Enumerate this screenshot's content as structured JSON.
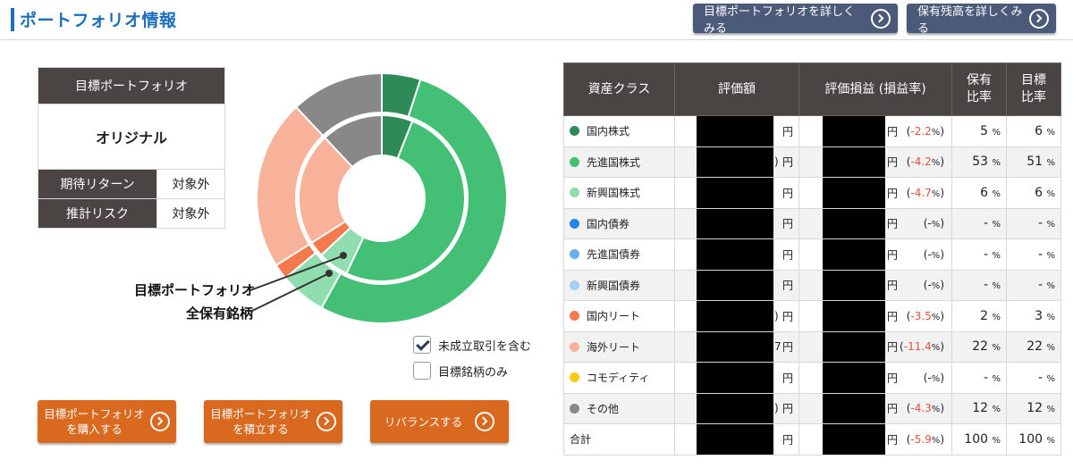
{
  "header": {
    "title": "ポートフォリオ情報",
    "btn_target_detail": "目標ポートフォリオを詳しくみる",
    "btn_holdings_detail": "保有残高を詳しくみる"
  },
  "target_panel": {
    "header": "目標ポートフォリオ",
    "name": "オリジナル",
    "expected_return_label": "期待リターン",
    "expected_return_value": "対象外",
    "risk_label": "推計リスク",
    "risk_value": "対象外"
  },
  "chart_data": {
    "type": "pie",
    "series": [
      {
        "name": "目標ポートフォリオ",
        "values": [
          6,
          51,
          6,
          0,
          0,
          0,
          3,
          22,
          0,
          12
        ]
      },
      {
        "name": "全保有銘柄",
        "values": [
          5,
          53,
          6,
          0,
          0,
          0,
          2,
          22,
          0,
          12
        ]
      }
    ],
    "categories": [
      "国内株式",
      "先進国株式",
      "新興国株式",
      "国内債券",
      "先進国債券",
      "新興国債券",
      "国内リート",
      "海外リート",
      "コモディティ",
      "その他"
    ]
  },
  "legend": {
    "inner": "目標ポートフォリオ",
    "outer": "全保有銘柄"
  },
  "options": {
    "pending_label": "未成立取引を含む",
    "pending_checked": true,
    "target_only_label": "目標銘柄のみ",
    "target_only_checked": false
  },
  "actions": {
    "buy": "目標ポートフォリオ\nを購入する",
    "accumulate": "目標ポートフォリオ\nを積立する",
    "rebalance": "リバランスする"
  },
  "table": {
    "headers": {
      "asset_class": "資産クラス",
      "valuation": "評価額",
      "pl": "評価損益 (損益率)",
      "holding": "保有\n比率",
      "target": "目標\n比率"
    },
    "yen": "円",
    "pct_unit": "%",
    "rows": [
      {
        "name": "国内株式",
        "color": "#2e8b57",
        "pl_rate": "-2.2",
        "holding": "5",
        "target": "6",
        "vtail": ""
      },
      {
        "name": "先進国株式",
        "color": "#43c075",
        "pl_rate": "-4.2",
        "holding": "53",
        "target": "51",
        "vtail": ")"
      },
      {
        "name": "新興国株式",
        "color": "#90ddb0",
        "pl_rate": "-4.7",
        "holding": "6",
        "target": "6",
        "vtail": ""
      },
      {
        "name": "国内債券",
        "color": "#2186e6",
        "pl_rate": "-",
        "holding": "-",
        "target": "-",
        "vtail": ""
      },
      {
        "name": "先進国債券",
        "color": "#6aaeee",
        "pl_rate": "-",
        "holding": "-",
        "target": "-",
        "vtail": ""
      },
      {
        "name": "新興国債券",
        "color": "#a8d0f5",
        "pl_rate": "-",
        "holding": "-",
        "target": "-",
        "vtail": ""
      },
      {
        "name": "国内リート",
        "color": "#f47a4e",
        "pl_rate": "-3.5",
        "holding": "2",
        "target": "3",
        "vtail": ")"
      },
      {
        "name": "海外リート",
        "color": "#f9b29a",
        "pl_rate": "-11.4",
        "holding": "22",
        "target": "22",
        "vtail": "7"
      },
      {
        "name": "コモディティ",
        "color": "#f5cc1a",
        "pl_rate": "-",
        "holding": "-",
        "target": "-",
        "vtail": ""
      },
      {
        "name": "その他",
        "color": "#888888",
        "pl_rate": "-4.3",
        "holding": "12",
        "target": "12",
        "vtail": ")"
      }
    ],
    "total": {
      "name": "合計",
      "pl_rate": "-5.9",
      "holding": "100",
      "target": "100"
    }
  }
}
